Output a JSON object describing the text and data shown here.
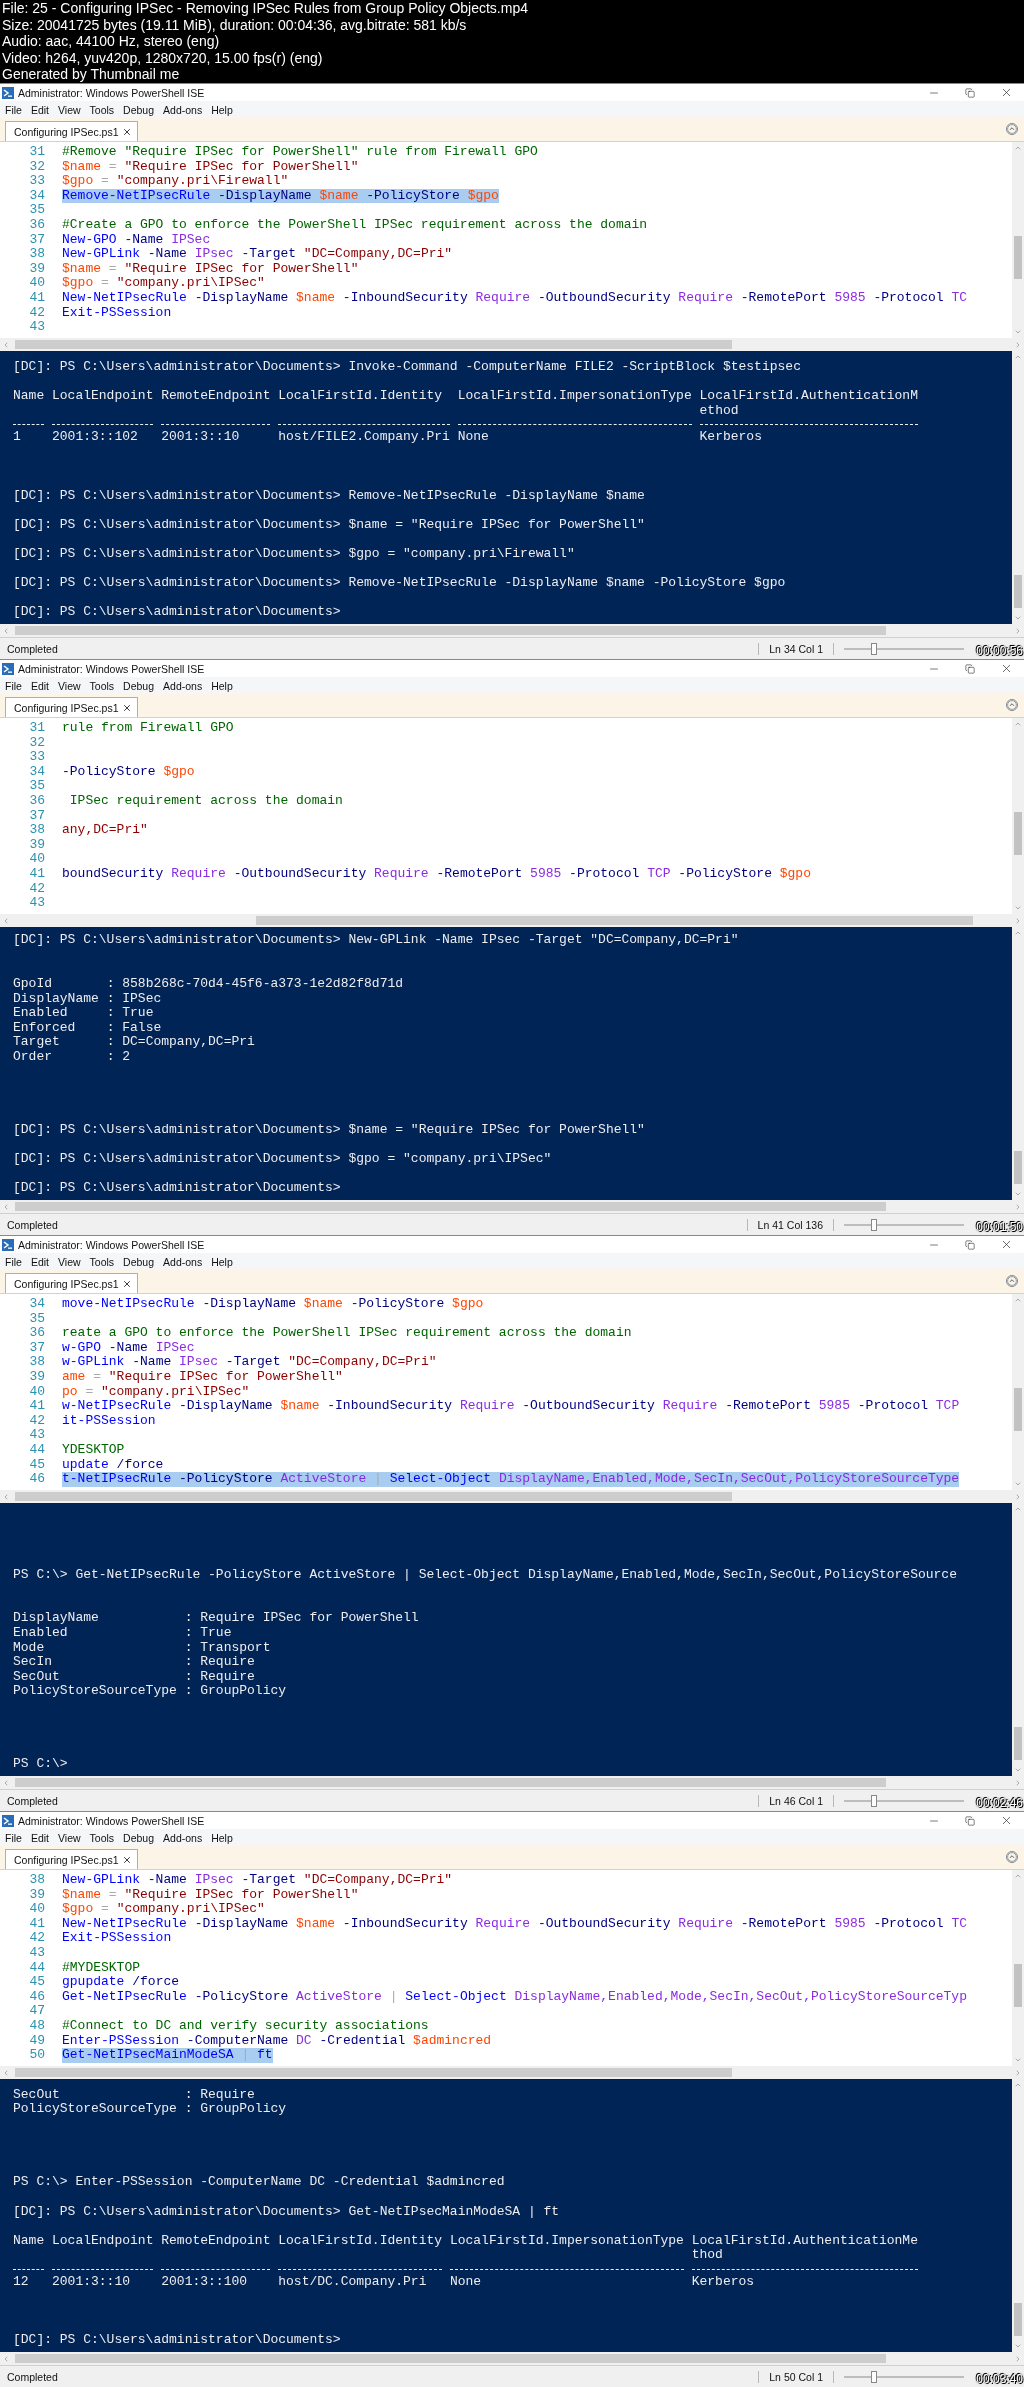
{
  "header": {
    "lines": [
      "File: 25 - Configuring IPSec - Removing IPSec Rules from Group Policy Objects.mp4",
      "Size: 20041725 bytes (19.11 MiB), duration: 00:04:36, avg.bitrate: 581 kb/s",
      "Audio: aac, 44100 Hz, stereo (eng)",
      "Video: h264, yuv420p, 1280x720, 15.00 fps(r) (eng)",
      "Generated by Thumbnail me"
    ]
  },
  "frames": [
    {
      "title": "Administrator: Windows PowerShell ISE",
      "menu": [
        "File",
        "Edit",
        "View",
        "Tools",
        "Debug",
        "Add-ons",
        "Help"
      ],
      "tab": {
        "label": "Configuring IPSec.ps1",
        "selected": true
      },
      "editor": {
        "lines": [
          {
            "number": "31",
            "selected": false,
            "tokens": [
              {
                "text": "#Remove \"Require IPSec for PowerShell\" rule from Firewall GPO",
                "kind": "comment"
              }
            ]
          },
          {
            "number": "32",
            "selected": false,
            "tokens": [
              {
                "text": "$name",
                "kind": "variable"
              },
              {
                "text": " = ",
                "kind": "operator"
              },
              {
                "text": "\"Require IPSec for PowerShell\"",
                "kind": "string"
              }
            ]
          },
          {
            "number": "33",
            "selected": false,
            "tokens": [
              {
                "text": "$gpo",
                "kind": "variable"
              },
              {
                "text": " = ",
                "kind": "operator"
              },
              {
                "text": "\"company.pri\\Firewall\"",
                "kind": "string"
              }
            ]
          },
          {
            "number": "34",
            "selected": true,
            "tokens": [
              {
                "text": "Remove-NetIPsecRule",
                "kind": "command"
              },
              {
                "text": " -DisplayName ",
                "kind": "parameter"
              },
              {
                "text": "$name",
                "kind": "variable"
              },
              {
                "text": " -PolicyStore ",
                "kind": "parameter"
              },
              {
                "text": "$gpo",
                "kind": "variable"
              }
            ]
          },
          {
            "number": "35",
            "selected": false
          },
          {
            "number": "36",
            "selected": false,
            "tokens": [
              {
                "text": "#Create a GPO to enforce the PowerShell IPSec requirement across the domain",
                "kind": "comment"
              }
            ]
          },
          {
            "number": "37",
            "selected": false,
            "tokens": [
              {
                "text": "New-GPO",
                "kind": "command"
              },
              {
                "text": " -Name ",
                "kind": "parameter"
              },
              {
                "text": "IPSec",
                "kind": "argument"
              }
            ]
          },
          {
            "number": "38",
            "selected": false,
            "tokens": [
              {
                "text": "New-GPLink",
                "kind": "command"
              },
              {
                "text": " -Name ",
                "kind": "parameter"
              },
              {
                "text": "IPsec",
                "kind": "argument"
              },
              {
                "text": " -Target ",
                "kind": "parameter"
              },
              {
                "text": "\"DC=Company,DC=Pri\"",
                "kind": "string"
              }
            ]
          },
          {
            "number": "39",
            "selected": false,
            "tokens": [
              {
                "text": "$name",
                "kind": "variable"
              },
              {
                "text": " = ",
                "kind": "operator"
              },
              {
                "text": "\"Require IPSec for PowerShell\"",
                "kind": "string"
              }
            ]
          },
          {
            "number": "40",
            "selected": false,
            "tokens": [
              {
                "text": "$gpo",
                "kind": "variable"
              },
              {
                "text": " = ",
                "kind": "operator"
              },
              {
                "text": "\"company.pri\\IPSec\"",
                "kind": "string"
              }
            ]
          },
          {
            "number": "41",
            "selected": false,
            "tokens": [
              {
                "text": "New-NetIPsecRule",
                "kind": "command"
              },
              {
                "text": " -DisplayName ",
                "kind": "parameter"
              },
              {
                "text": "$name",
                "kind": "variable"
              },
              {
                "text": " -InboundSecurity ",
                "kind": "parameter"
              },
              {
                "text": "Require",
                "kind": "argument"
              },
              {
                "text": " -OutboundSecurity ",
                "kind": "parameter"
              },
              {
                "text": "Require",
                "kind": "argument"
              },
              {
                "text": " -RemotePort ",
                "kind": "parameter"
              },
              {
                "text": "5985",
                "kind": "argument"
              },
              {
                "text": " -Protocol ",
                "kind": "parameter"
              },
              {
                "text": "TC",
                "kind": "argument"
              }
            ]
          },
          {
            "number": "42",
            "selected": false,
            "tokens": [
              {
                "text": "Exit-PSSession",
                "kind": "command"
              }
            ]
          },
          {
            "number": "43",
            "selected": false
          }
        ]
      },
      "console": {
        "blocks": [
          {
            "kind": "prompt",
            "text": "[DC]: PS C:\\Users\\administrator\\Documents> Invoke-Command -ComputerName FILE2 -ScriptBlock $testipsec"
          },
          {
            "kind": "table",
            "columns": [
              {
                "header": [
                  "Name"
                ],
                "value": "1"
              },
              {
                "header": [
                  "LocalEndpoint"
                ],
                "value": "2001:3::102"
              },
              {
                "header": [
                  "RemoteEndpoint"
                ],
                "value": "2001:3::10"
              },
              {
                "header": [
                  "LocalFirstId.Identity"
                ],
                "value": "host/FILE2.Company.Pri"
              },
              {
                "header": [
                  "LocalFirstId.ImpersonationType"
                ],
                "value": "None"
              },
              {
                "header": [
                  "LocalFirstId.AuthenticationM",
                  "ethod"
                ],
                "value": "Kerberos"
              }
            ]
          },
          {
            "kind": "prompt",
            "text": "[DC]: PS C:\\Users\\administrator\\Documents> Remove-NetIPsecRule -DisplayName $name"
          },
          {
            "kind": "prompt",
            "text": "[DC]: PS C:\\Users\\administrator\\Documents> $name = \"Require IPSec for PowerShell\""
          },
          {
            "kind": "prompt",
            "text": "[DC]: PS C:\\Users\\administrator\\Documents> $gpo = \"company.pri\\Firewall\""
          },
          {
            "kind": "prompt",
            "text": "[DC]: PS C:\\Users\\administrator\\Documents> Remove-NetIPsecRule -DisplayName $name -PolicyStore $gpo"
          },
          {
            "kind": "prompt",
            "text": "[DC]: PS C:\\Users\\administrator\\Documents>"
          }
        ]
      },
      "status": {
        "text": "Completed",
        "position": "Ln 34 Col 1",
        "zoom": {
          "level": 0.25
        }
      },
      "timestamp": "00:00:56"
    },
    {
      "title": "Administrator: Windows PowerShell ISE",
      "menu": [
        "File",
        "Edit",
        "View",
        "Tools",
        "Debug",
        "Add-ons",
        "Help"
      ],
      "tab": {
        "label": "Configuring IPSec.ps1",
        "selected": true
      },
      "editor": {
        "lines": [
          {
            "number": "31",
            "selected": false,
            "tokens": [
              {
                "text": "rule from Firewall GPO",
                "kind": "comment"
              }
            ]
          },
          {
            "number": "32",
            "selected": false
          },
          {
            "number": "33",
            "selected": false
          },
          {
            "number": "34",
            "selected": false,
            "tokens": [
              {
                "text": "-PolicyStore ",
                "kind": "parameter"
              },
              {
                "text": "$gpo",
                "kind": "variable"
              }
            ]
          },
          {
            "number": "35",
            "selected": false
          },
          {
            "number": "36",
            "selected": false,
            "tokens": [
              {
                "text": " IPSec requirement across the domain",
                "kind": "comment"
              }
            ]
          },
          {
            "number": "37",
            "selected": false
          },
          {
            "number": "38",
            "selected": false,
            "tokens": [
              {
                "text": "any,DC=Pri\"",
                "kind": "string"
              }
            ]
          },
          {
            "number": "39",
            "selected": false
          },
          {
            "number": "40",
            "selected": false
          },
          {
            "number": "41",
            "selected": false,
            "tokens": [
              {
                "text": "boundSecurity ",
                "kind": "parameter"
              },
              {
                "text": "Require",
                "kind": "argument"
              },
              {
                "text": " -OutboundSecurity ",
                "kind": "parameter"
              },
              {
                "text": "Require",
                "kind": "argument"
              },
              {
                "text": " -RemotePort ",
                "kind": "parameter"
              },
              {
                "text": "5985",
                "kind": "argument"
              },
              {
                "text": " -Protocol ",
                "kind": "parameter"
              },
              {
                "text": "TCP",
                "kind": "argument"
              },
              {
                "text": " -PolicyStore ",
                "kind": "parameter"
              },
              {
                "text": "$gpo",
                "kind": "variable"
              }
            ]
          },
          {
            "number": "42",
            "selected": false
          },
          {
            "number": "43",
            "selected": false
          }
        ]
      },
      "console": {
        "blocks": [
          {
            "kind": "prompt",
            "text": "[DC]: PS C:\\Users\\administrator\\Documents> New-GPLink -Name IPsec -Target \"DC=Company,DC=Pri\""
          },
          {
            "kind": "props",
            "items": [
              {
                "name": "GpoId",
                "value": ": 858b268c-70d4-45f6-a373-1e2d82f8d71d"
              },
              {
                "name": "DisplayName",
                "value": ": IPSec"
              },
              {
                "name": "Enabled",
                "value": ": True"
              },
              {
                "name": "Enforced",
                "value": ": False"
              },
              {
                "name": "Target",
                "value": ": DC=Company,DC=Pri"
              },
              {
                "name": "Order",
                "value": ": 2"
              }
            ]
          },
          {
            "kind": "prompt",
            "text": "[DC]: PS C:\\Users\\administrator\\Documents> $name = \"Require IPSec for PowerShell\""
          },
          {
            "kind": "prompt",
            "text": "[DC]: PS C:\\Users\\administrator\\Documents> $gpo = \"company.pri\\IPSec\""
          },
          {
            "kind": "prompt",
            "text": "[DC]: PS C:\\Users\\administrator\\Documents>"
          }
        ]
      },
      "status": {
        "text": "Completed",
        "position": "Ln 41 Col 136",
        "zoom": {
          "level": 0.25
        }
      },
      "timestamp": "00:01:50"
    },
    {
      "title": "Administrator: Windows PowerShell ISE",
      "menu": [
        "File",
        "Edit",
        "View",
        "Tools",
        "Debug",
        "Add-ons",
        "Help"
      ],
      "tab": {
        "label": "Configuring IPSec.ps1",
        "selected": true
      },
      "editor": {
        "lines": [
          {
            "number": "34",
            "selected": false,
            "tokens": [
              {
                "text": "move-NetIPsecRule",
                "kind": "command"
              },
              {
                "text": " -DisplayName ",
                "kind": "parameter"
              },
              {
                "text": "$name",
                "kind": "variable"
              },
              {
                "text": " -PolicyStore ",
                "kind": "parameter"
              },
              {
                "text": "$gpo",
                "kind": "variable"
              }
            ]
          },
          {
            "number": "35",
            "selected": false
          },
          {
            "number": "36",
            "selected": false,
            "tokens": [
              {
                "text": "reate a GPO to enforce the PowerShell IPSec requirement across the domain",
                "kind": "comment"
              }
            ]
          },
          {
            "number": "37",
            "selected": false,
            "tokens": [
              {
                "text": "w-GPO",
                "kind": "command"
              },
              {
                "text": " -Name ",
                "kind": "parameter"
              },
              {
                "text": "IPSec",
                "kind": "argument"
              }
            ]
          },
          {
            "number": "38",
            "selected": false,
            "tokens": [
              {
                "text": "w-GPLink",
                "kind": "command"
              },
              {
                "text": " -Name ",
                "kind": "parameter"
              },
              {
                "text": "IPsec",
                "kind": "argument"
              },
              {
                "text": " -Target ",
                "kind": "parameter"
              },
              {
                "text": "\"DC=Company,DC=Pri\"",
                "kind": "string"
              }
            ]
          },
          {
            "number": "39",
            "selected": false,
            "tokens": [
              {
                "text": "ame",
                "kind": "variable"
              },
              {
                "text": " = ",
                "kind": "operator"
              },
              {
                "text": "\"Require IPSec for PowerShell\"",
                "kind": "string"
              }
            ]
          },
          {
            "number": "40",
            "selected": false,
            "tokens": [
              {
                "text": "po",
                "kind": "variable"
              },
              {
                "text": " = ",
                "kind": "operator"
              },
              {
                "text": "\"company.pri\\IPSec\"",
                "kind": "string"
              }
            ]
          },
          {
            "number": "41",
            "selected": false,
            "tokens": [
              {
                "text": "w-NetIPsecRule",
                "kind": "command"
              },
              {
                "text": " -DisplayName ",
                "kind": "parameter"
              },
              {
                "text": "$name",
                "kind": "variable"
              },
              {
                "text": " -InboundSecurity ",
                "kind": "parameter"
              },
              {
                "text": "Require",
                "kind": "argument"
              },
              {
                "text": " -OutboundSecurity ",
                "kind": "parameter"
              },
              {
                "text": "Require",
                "kind": "argument"
              },
              {
                "text": " -RemotePort ",
                "kind": "parameter"
              },
              {
                "text": "5985",
                "kind": "argument"
              },
              {
                "text": " -Protocol ",
                "kind": "parameter"
              },
              {
                "text": "TCP",
                "kind": "argument"
              }
            ]
          },
          {
            "number": "42",
            "selected": false,
            "tokens": [
              {
                "text": "it-PSSession",
                "kind": "command"
              }
            ]
          },
          {
            "number": "43",
            "selected": false
          },
          {
            "number": "44",
            "selected": false,
            "tokens": [
              {
                "text": "YDESKTOP",
                "kind": "comment"
              }
            ]
          },
          {
            "number": "45",
            "selected": false,
            "tokens": [
              {
                "text": "update",
                "kind": "command"
              },
              {
                "text": " /force",
                "kind": "parameter"
              }
            ]
          },
          {
            "number": "46",
            "selected": true,
            "tokens": [
              {
                "text": "t-NetIPsecRule",
                "kind": "command"
              },
              {
                "text": " -PolicyStore ",
                "kind": "parameter"
              },
              {
                "text": "ActiveStore",
                "kind": "argument"
              },
              {
                "text": " | ",
                "kind": "operator"
              },
              {
                "text": "Select-Object ",
                "kind": "command"
              },
              {
                "text": "DisplayName,Enabled,Mode,SecIn,SecOut,PolicyStoreSourceType",
                "kind": "argument"
              }
            ]
          }
        ]
      },
      "console": {
        "blocks": [
          {
            "kind": "prompt",
            "text": "PS C:\\> Get-NetIPsecRule -PolicyStore ActiveStore | Select-Object DisplayName,Enabled,Mode,SecIn,SecOut,PolicyStoreSource"
          },
          {
            "kind": "props",
            "items": [
              {
                "name": "DisplayName",
                "value": ": Require IPSec for PowerShell"
              },
              {
                "name": "Enabled",
                "value": ": True"
              },
              {
                "name": "Mode",
                "value": ": Transport"
              },
              {
                "name": "SecIn",
                "value": ": Require"
              },
              {
                "name": "SecOut",
                "value": ": Require"
              },
              {
                "name": "PolicyStoreSourceType",
                "value": ": GroupPolicy"
              }
            ]
          },
          {
            "kind": "prompt",
            "text": "PS C:\\>"
          }
        ]
      },
      "status": {
        "text": "Completed",
        "position": "Ln 46 Col 1",
        "zoom": {
          "level": 0.25
        }
      },
      "timestamp": "00:02:46"
    },
    {
      "title": "Administrator: Windows PowerShell ISE",
      "menu": [
        "File",
        "Edit",
        "View",
        "Tools",
        "Debug",
        "Add-ons",
        "Help"
      ],
      "tab": {
        "label": "Configuring IPSec.ps1",
        "selected": true
      },
      "editor": {
        "lines": [
          {
            "number": "38",
            "selected": false,
            "tokens": [
              {
                "text": "New-GPLink",
                "kind": "command"
              },
              {
                "text": " -Name ",
                "kind": "parameter"
              },
              {
                "text": "IPsec",
                "kind": "argument"
              },
              {
                "text": " -Target ",
                "kind": "parameter"
              },
              {
                "text": "\"DC=Company,DC=Pri\"",
                "kind": "string"
              }
            ]
          },
          {
            "number": "39",
            "selected": false,
            "tokens": [
              {
                "text": "$name",
                "kind": "variable"
              },
              {
                "text": " = ",
                "kind": "operator"
              },
              {
                "text": "\"Require IPSec for PowerShell\"",
                "kind": "string"
              }
            ]
          },
          {
            "number": "40",
            "selected": false,
            "tokens": [
              {
                "text": "$gpo",
                "kind": "variable"
              },
              {
                "text": " = ",
                "kind": "operator"
              },
              {
                "text": "\"company.pri\\IPSec\"",
                "kind": "string"
              }
            ]
          },
          {
            "number": "41",
            "selected": false,
            "tokens": [
              {
                "text": "New-NetIPsecRule",
                "kind": "command"
              },
              {
                "text": " -DisplayName ",
                "kind": "parameter"
              },
              {
                "text": "$name",
                "kind": "variable"
              },
              {
                "text": " -InboundSecurity ",
                "kind": "parameter"
              },
              {
                "text": "Require",
                "kind": "argument"
              },
              {
                "text": " -OutboundSecurity ",
                "kind": "parameter"
              },
              {
                "text": "Require",
                "kind": "argument"
              },
              {
                "text": " -RemotePort ",
                "kind": "parameter"
              },
              {
                "text": "5985",
                "kind": "argument"
              },
              {
                "text": " -Protocol ",
                "kind": "parameter"
              },
              {
                "text": "TC",
                "kind": "argument"
              }
            ]
          },
          {
            "number": "42",
            "selected": false,
            "tokens": [
              {
                "text": "Exit-PSSession",
                "kind": "command"
              }
            ]
          },
          {
            "number": "43",
            "selected": false
          },
          {
            "number": "44",
            "selected": false,
            "tokens": [
              {
                "text": "#MYDESKTOP",
                "kind": "comment"
              }
            ]
          },
          {
            "number": "45",
            "selected": false,
            "tokens": [
              {
                "text": "gpupdate",
                "kind": "command"
              },
              {
                "text": " /force",
                "kind": "parameter"
              }
            ]
          },
          {
            "number": "46",
            "selected": false,
            "tokens": [
              {
                "text": "Get-NetIPsecRule",
                "kind": "command"
              },
              {
                "text": " -PolicyStore ",
                "kind": "parameter"
              },
              {
                "text": "ActiveStore",
                "kind": "argument"
              },
              {
                "text": " | ",
                "kind": "operator"
              },
              {
                "text": "Select-Object ",
                "kind": "command"
              },
              {
                "text": "DisplayName,Enabled,Mode,SecIn,SecOut,PolicyStoreSourceTyp",
                "kind": "argument"
              }
            ]
          },
          {
            "number": "47",
            "selected": false
          },
          {
            "number": "48",
            "selected": false,
            "tokens": [
              {
                "text": "#Connect to DC and verify security associations",
                "kind": "comment"
              }
            ]
          },
          {
            "number": "49",
            "selected": false,
            "tokens": [
              {
                "text": "Enter-PSSession",
                "kind": "command"
              },
              {
                "text": " -ComputerName ",
                "kind": "parameter"
              },
              {
                "text": "DC",
                "kind": "argument"
              },
              {
                "text": " -Credential ",
                "kind": "parameter"
              },
              {
                "text": "$admincred",
                "kind": "variable"
              }
            ]
          },
          {
            "number": "50",
            "selected": true,
            "tokens": [
              {
                "text": "Get-NetIPsecMainModeSA",
                "kind": "command"
              },
              {
                "text": " | ",
                "kind": "operator"
              },
              {
                "text": "ft",
                "kind": "command"
              }
            ]
          }
        ]
      },
      "console": {
        "blocks": [
          {
            "kind": "props",
            "items": [
              {
                "name": "SecOut",
                "value": ": Require"
              },
              {
                "name": "PolicyStoreSourceType",
                "value": ": GroupPolicy"
              }
            ]
          },
          {
            "kind": "prompt",
            "text": "PS C:\\> Enter-PSSession -ComputerName DC -Credential $admincred"
          },
          {
            "kind": "prompt",
            "text": "[DC]: PS C:\\Users\\administrator\\Documents> Get-NetIPsecMainModeSA | ft"
          },
          {
            "kind": "table",
            "columns": [
              {
                "header": [
                  "Name"
                ],
                "value": "12"
              },
              {
                "header": [
                  "LocalEndpoint"
                ],
                "value": "2001:3::10"
              },
              {
                "header": [
                  "RemoteEndpoint"
                ],
                "value": "2001:3::100"
              },
              {
                "header": [
                  "LocalFirstId.Identity"
                ],
                "value": "host/DC.Company.Pri"
              },
              {
                "header": [
                  "LocalFirstId.ImpersonationType"
                ],
                "value": "None"
              },
              {
                "header": [
                  "LocalFirstId.AuthenticationMe",
                  "thod"
                ],
                "value": "Kerberos"
              }
            ]
          },
          {
            "kind": "prompt",
            "text": "[DC]: PS C:\\Users\\administrator\\Documents>"
          }
        ]
      },
      "status": {
        "text": "Completed",
        "position": "Ln 50 Col 1",
        "zoom": {
          "level": 0.25
        }
      },
      "timestamp": "00:03:40"
    }
  ]
}
